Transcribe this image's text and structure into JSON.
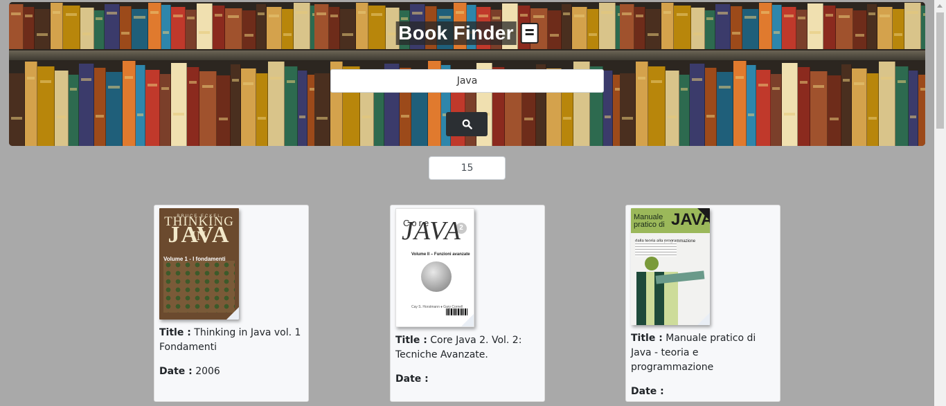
{
  "header": {
    "title": "Book Finder",
    "title_icon": "book-icon",
    "search_value": "Java",
    "search_button_icon": "search-icon"
  },
  "results_count": "15",
  "books": [
    {
      "title_label": "Title :",
      "title": "Thinking in Java vol. 1 Fondamenti",
      "date_label": "Date :",
      "date": "2006",
      "cover": {
        "author": "BRUCE ECKEL",
        "line1": "THINKING IN",
        "line2": "JAVA",
        "subtitle": "Volume 1 - I fondamenti"
      }
    },
    {
      "title_label": "Title :",
      "title": "Core Java 2. Vol. 2: Tecniche Avanzate.",
      "date_label": "Date :",
      "date": "",
      "cover": {
        "line1": "Core",
        "badge": "2",
        "line2": "JAVA",
        "subtitle": "Volume II – Funzioni avanzate",
        "authors": "Cay S. Horstmann ♦ Gary Cornell"
      }
    },
    {
      "title_label": "Title :",
      "title": "Manuale pratico di Java - teoria e programmazione",
      "date_label": "Date :",
      "date": "",
      "cover": {
        "line1": "Manuale pratico di",
        "line2": "JAVA",
        "subtitle": "dalla teoria alla programmazione"
      }
    }
  ],
  "colors": {
    "page_background": "#a9a9a9",
    "card_background": "#f7f8fa",
    "search_button": "#2b2f33"
  }
}
